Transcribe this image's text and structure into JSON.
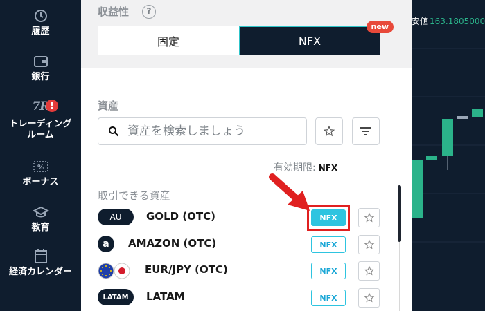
{
  "sidebar": {
    "items": [
      {
        "label": "履歴",
        "icon": "history-icon"
      },
      {
        "label": "銀行",
        "icon": "wallet-icon"
      },
      {
        "label": "トレーディング\nルーム",
        "icon": "tr-logo-icon",
        "logo_text": "7R",
        "alert": "!"
      },
      {
        "label": "ボーナス",
        "icon": "bonus-percent-icon"
      },
      {
        "label": "教育",
        "icon": "graduation-cap-icon"
      },
      {
        "label": "経済カレンダー",
        "icon": "calendar-icon"
      }
    ]
  },
  "profitability": {
    "title": "収益性",
    "help": "?",
    "tabs": {
      "fixed": "固定",
      "nfx": "NFX"
    },
    "new_badge": "new"
  },
  "assets": {
    "title": "資産",
    "search_placeholder": "資産を検索しましょう",
    "expiry_label": "有効期限:",
    "expiry_value": "NFX",
    "tradable_title": "取引できる資産",
    "rows": [
      {
        "badge": "AU",
        "name": "GOLD (OTC)",
        "tag": "NFX"
      },
      {
        "badge": "a",
        "name": "AMAZON (OTC)",
        "tag": "NFX"
      },
      {
        "badge": "",
        "name": "EUR/JPY (OTC)",
        "tag": "NFX"
      },
      {
        "badge": "LATAM",
        "name": "LATAM",
        "tag": "NFX"
      }
    ]
  },
  "chart": {
    "price_label": "安値",
    "price_value": "163.1805000"
  },
  "colors": {
    "navy": "#0f1d2e",
    "accent_cyan": "#2ec4e0",
    "alert_red": "#e23b3b",
    "candle_green": "#2bb38a"
  }
}
